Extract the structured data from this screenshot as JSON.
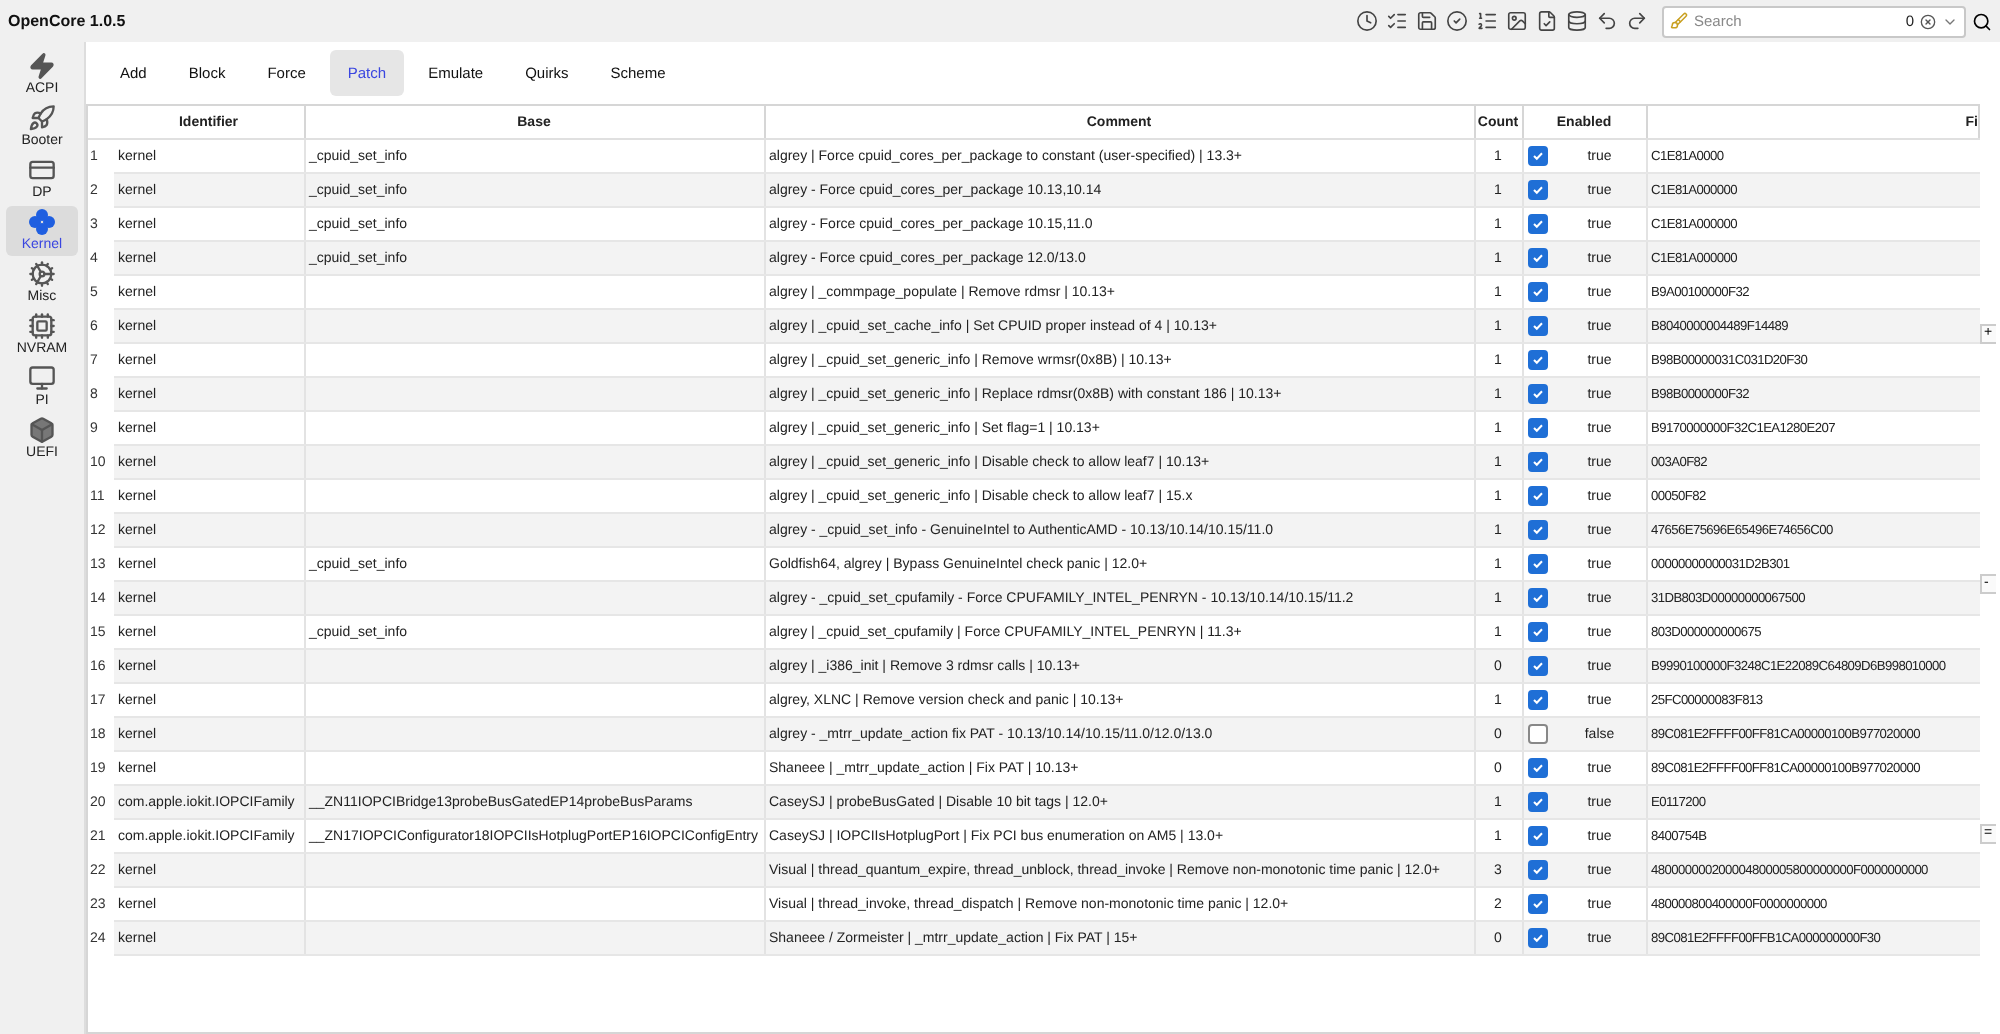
{
  "window": {
    "title": "OpenCore 1.0.5"
  },
  "search": {
    "placeholder": "Search",
    "count": "0"
  },
  "sidebar": {
    "items": [
      {
        "label": "ACPI",
        "kind": "acpi",
        "selected": false
      },
      {
        "label": "Booter",
        "kind": "booter",
        "selected": false
      },
      {
        "label": "DP",
        "kind": "dp",
        "selected": false
      },
      {
        "label": "Kernel",
        "kind": "kernel",
        "selected": true
      },
      {
        "label": "Misc",
        "kind": "misc",
        "selected": false
      },
      {
        "label": "NVRAM",
        "kind": "nvram",
        "selected": false
      },
      {
        "label": "PI",
        "kind": "pi",
        "selected": false
      },
      {
        "label": "UEFI",
        "kind": "uefi",
        "selected": false
      }
    ]
  },
  "tabs": [
    {
      "label": "Add",
      "selected": false
    },
    {
      "label": "Block",
      "selected": false
    },
    {
      "label": "Force",
      "selected": false
    },
    {
      "label": "Patch",
      "selected": true
    },
    {
      "label": "Emulate",
      "selected": false
    },
    {
      "label": "Quirks",
      "selected": false
    },
    {
      "label": "Scheme",
      "selected": false
    }
  ],
  "table": {
    "columns": [
      "Identifier",
      "Base",
      "Comment",
      "Count",
      "Enabled",
      "Fi"
    ],
    "rows": [
      {
        "index": "1",
        "identifier": "kernel",
        "base": "_cpuid_set_info",
        "comment": "algrey | Force cpuid_cores_per_package to constant (user-specified) | 13.3+",
        "count": "1",
        "enabled": true,
        "enabled_text": "true",
        "find": "C1E81A0000"
      },
      {
        "index": "2",
        "identifier": "kernel",
        "base": "_cpuid_set_info",
        "comment": "algrey - Force cpuid_cores_per_package 10.13,10.14",
        "count": "1",
        "enabled": true,
        "enabled_text": "true",
        "find": "C1E81A000000"
      },
      {
        "index": "3",
        "identifier": "kernel",
        "base": "_cpuid_set_info",
        "comment": "algrey - Force cpuid_cores_per_package 10.15,11.0",
        "count": "1",
        "enabled": true,
        "enabled_text": "true",
        "find": "C1E81A000000"
      },
      {
        "index": "4",
        "identifier": "kernel",
        "base": "_cpuid_set_info",
        "comment": "algrey - Force cpuid_cores_per_package 12.0/13.0",
        "count": "1",
        "enabled": true,
        "enabled_text": "true",
        "find": "C1E81A000000"
      },
      {
        "index": "5",
        "identifier": "kernel",
        "base": "",
        "comment": "algrey | _commpage_populate | Remove rdmsr | 10.13+",
        "count": "1",
        "enabled": true,
        "enabled_text": "true",
        "find": "B9A00100000F32"
      },
      {
        "index": "6",
        "identifier": "kernel",
        "base": "",
        "comment": "algrey | _cpuid_set_cache_info | Set CPUID proper instead of 4 | 10.13+",
        "count": "1",
        "enabled": true,
        "enabled_text": "true",
        "find": "B8040000004489F14489"
      },
      {
        "index": "7",
        "identifier": "kernel",
        "base": "",
        "comment": "algrey | _cpuid_set_generic_info | Remove wrmsr(0x8B) | 10.13+",
        "count": "1",
        "enabled": true,
        "enabled_text": "true",
        "find": "B98B00000031C031D20F30"
      },
      {
        "index": "8",
        "identifier": "kernel",
        "base": "",
        "comment": "algrey | _cpuid_set_generic_info | Replace rdmsr(0x8B) with constant 186 | 10.13+",
        "count": "1",
        "enabled": true,
        "enabled_text": "true",
        "find": "B98B0000000F32"
      },
      {
        "index": "9",
        "identifier": "kernel",
        "base": "",
        "comment": "algrey | _cpuid_set_generic_info | Set flag=1 | 10.13+",
        "count": "1",
        "enabled": true,
        "enabled_text": "true",
        "find": "B9170000000F32C1EA1280E207"
      },
      {
        "index": "10",
        "identifier": "kernel",
        "base": "",
        "comment": "algrey | _cpuid_set_generic_info | Disable check to allow leaf7 | 10.13+",
        "count": "1",
        "enabled": true,
        "enabled_text": "true",
        "find": "003A0F82"
      },
      {
        "index": "11",
        "identifier": "kernel",
        "base": "",
        "comment": "algrey | _cpuid_set_generic_info | Disable check to allow leaf7 | 15.x",
        "count": "1",
        "enabled": true,
        "enabled_text": "true",
        "find": "00050F82"
      },
      {
        "index": "12",
        "identifier": "kernel",
        "base": "",
        "comment": "algrey - _cpuid_set_info - GenuineIntel to AuthenticAMD - 10.13/10.14/10.15/11.0",
        "count": "1",
        "enabled": true,
        "enabled_text": "true",
        "find": "47656E75696E65496E74656C00"
      },
      {
        "index": "13",
        "identifier": "kernel",
        "base": "_cpuid_set_info",
        "comment": "Goldfish64, algrey | Bypass GenuineIntel check panic | 12.0+",
        "count": "1",
        "enabled": true,
        "enabled_text": "true",
        "find": "00000000000031D2B301"
      },
      {
        "index": "14",
        "identifier": "kernel",
        "base": "",
        "comment": "algrey - _cpuid_set_cpufamily - Force CPUFAMILY_INTEL_PENRYN - 10.13/10.14/10.15/11.2",
        "count": "1",
        "enabled": true,
        "enabled_text": "true",
        "find": "31DB803D00000000067500"
      },
      {
        "index": "15",
        "identifier": "kernel",
        "base": "_cpuid_set_info",
        "comment": "algrey | _cpuid_set_cpufamily | Force CPUFAMILY_INTEL_PENRYN | 11.3+",
        "count": "1",
        "enabled": true,
        "enabled_text": "true",
        "find": "803D000000000675"
      },
      {
        "index": "16",
        "identifier": "kernel",
        "base": "",
        "comment": "algrey | _i386_init | Remove 3 rdmsr calls | 10.13+",
        "count": "0",
        "enabled": true,
        "enabled_text": "true",
        "find": "B9990100000F3248C1E22089C64809D6B998010000"
      },
      {
        "index": "17",
        "identifier": "kernel",
        "base": "",
        "comment": "algrey, XLNC | Remove version check and panic | 10.13+",
        "count": "1",
        "enabled": true,
        "enabled_text": "true",
        "find": "25FC00000083F813"
      },
      {
        "index": "18",
        "identifier": "kernel",
        "base": "",
        "comment": "algrey - _mtrr_update_action fix PAT - 10.13/10.14/10.15/11.0/12.0/13.0",
        "count": "0",
        "enabled": false,
        "enabled_text": "false",
        "find": "89C081E2FFFF00FF81CA00000100B977020000"
      },
      {
        "index": "19",
        "identifier": "kernel",
        "base": "",
        "comment": "Shaneee | _mtrr_update_action | Fix PAT | 10.13+",
        "count": "0",
        "enabled": true,
        "enabled_text": "true",
        "find": "89C081E2FFFF00FF81CA00000100B977020000"
      },
      {
        "index": "20",
        "identifier": "com.apple.iokit.IOPCIFamily",
        "base": "__ZN11IOPCIBridge13probeBusGatedEP14probeBusParams",
        "comment": "CaseySJ | probeBusGated | Disable 10 bit tags | 12.0+",
        "count": "1",
        "enabled": true,
        "enabled_text": "true",
        "find": "E0117200"
      },
      {
        "index": "21",
        "identifier": "com.apple.iokit.IOPCIFamily",
        "base": "__ZN17IOPCIConfigurator18IOPCIIsHotplugPortEP16IOPCIConfigEntry",
        "comment": "CaseySJ | IOPCIIsHotplugPort | Fix PCI bus enumeration on AM5 | 13.0+",
        "count": "1",
        "enabled": true,
        "enabled_text": "true",
        "find": "8400754B"
      },
      {
        "index": "22",
        "identifier": "kernel",
        "base": "",
        "comment": "Visual | thread_quantum_expire, thread_unblock, thread_invoke | Remove non-monotonic time panic | 12.0+",
        "count": "3",
        "enabled": true,
        "enabled_text": "true",
        "find": "480000000200004800005800000000F0000000000"
      },
      {
        "index": "23",
        "identifier": "kernel",
        "base": "",
        "comment": "Visual | thread_invoke, thread_dispatch | Remove non-monotonic time panic | 12.0+",
        "count": "2",
        "enabled": true,
        "enabled_text": "true",
        "find": "480000800400000F0000000000"
      },
      {
        "index": "24",
        "identifier": "kernel",
        "base": "",
        "comment": "Shaneee / Zormeister | _mtrr_update_action | Fix PAT | 15+",
        "count": "0",
        "enabled": true,
        "enabled_text": "true",
        "find": "89C081E2FFFF00FFB1CA000000000F30"
      }
    ]
  },
  "side_buttons": [
    "+",
    "-",
    "="
  ]
}
